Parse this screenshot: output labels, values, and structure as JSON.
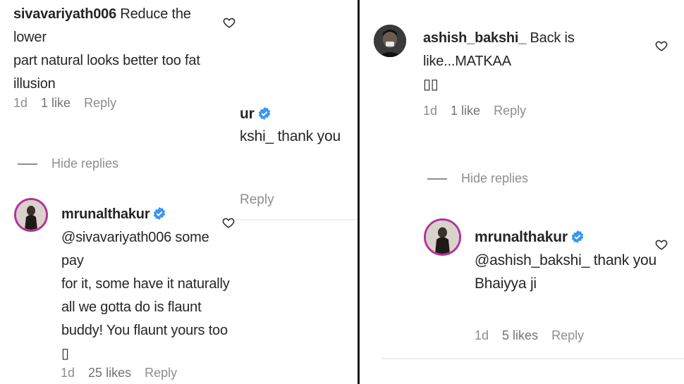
{
  "left_panel": {
    "comment": {
      "username": "sivavariyath006",
      "text_line1": "Reduce the lower",
      "text_line2": "part natural looks better too fat",
      "text_line3": "illusion",
      "time": "1d",
      "likes": "1 like",
      "reply": "Reply"
    },
    "hide_replies": "Hide replies",
    "reply": {
      "username": "mrunalthakur",
      "line1": "@sivavariyath006 some pay",
      "line2": "for it, some have it naturally",
      "line3": "all we gotta do is flaunt",
      "line4": "buddy! You flaunt yours too",
      "line5": "▯",
      "time": "1d",
      "likes": "25 likes",
      "reply": "Reply"
    },
    "partial": {
      "username_fragment": "ur",
      "text_fragment": "kshi_ thank you",
      "reply": "Reply"
    }
  },
  "right_panel": {
    "comment": {
      "username": "ashish_bakshi_",
      "text_line1": "Back is like...MATKAA",
      "text_line2": "▯▯",
      "time": "1d",
      "likes": "1 like",
      "reply": "Reply"
    },
    "hide_replies": "Hide replies",
    "reply": {
      "username": "mrunalthakur",
      "line1": "@ashish_bakshi_ thank you",
      "line2": "Bhaiyya ji",
      "time": "1d",
      "likes": "5 likes",
      "reply": "Reply"
    }
  },
  "colors": {
    "text": "#262626",
    "meta": "#8e8e8e",
    "verified": "#3897f0",
    "story_ring": "#b2339a"
  },
  "icons": [
    "heart-icon",
    "verified-badge-icon"
  ]
}
